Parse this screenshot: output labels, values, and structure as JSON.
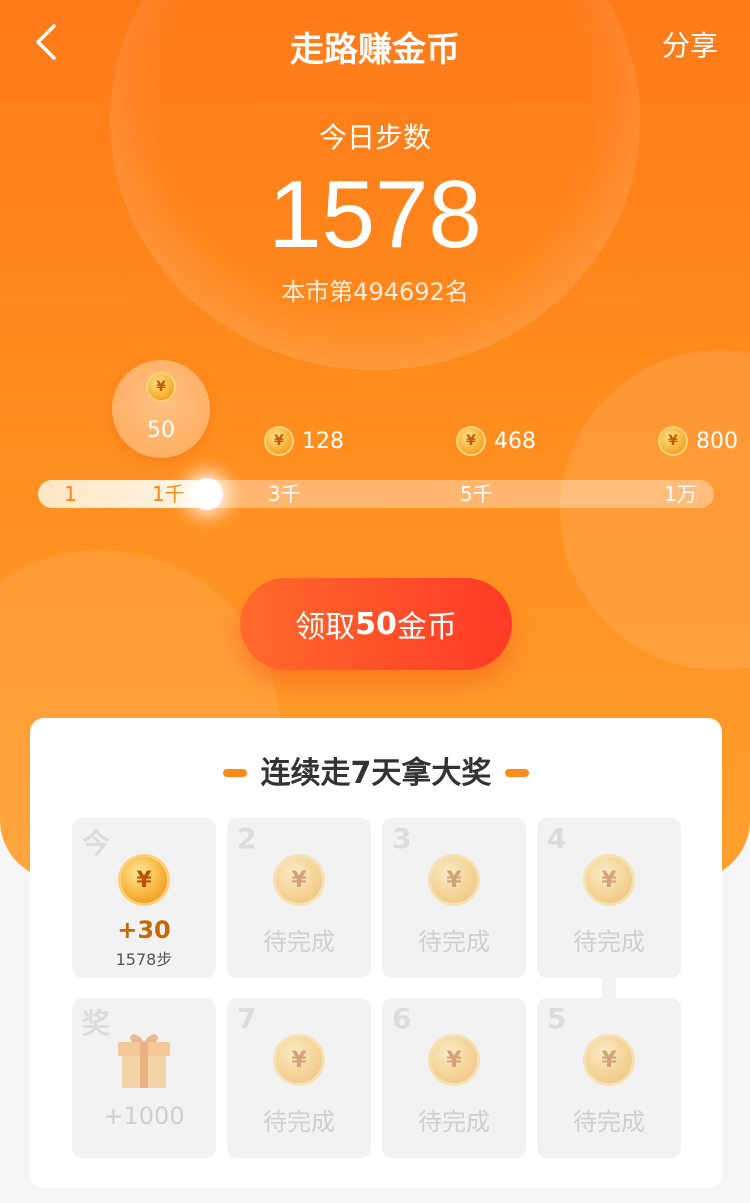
{
  "header": {
    "title": "走路赚金币",
    "share_label": "分享"
  },
  "steps": {
    "label": "今日步数",
    "value": "1578",
    "rank": "本市第494692名"
  },
  "milestones": {
    "current_bubble_reward": "50",
    "rewards": [
      "128",
      "468",
      "800"
    ],
    "coin_symbol": "¥",
    "ticks": [
      "1",
      "1千",
      "3千",
      "5千",
      "1万"
    ],
    "progress_fraction": 0.25
  },
  "claim": {
    "prefix": "领取",
    "amount": "50",
    "suffix": "金币"
  },
  "streak": {
    "title": "连续走7天拿大奖",
    "days": [
      {
        "label": "今",
        "reward": "+30",
        "steps": "1578步",
        "coin": "¥"
      },
      {
        "label": "2",
        "status": "待完成",
        "coin": "¥"
      },
      {
        "label": "3",
        "status": "待完成",
        "coin": "¥"
      },
      {
        "label": "4",
        "status": "待完成",
        "coin": "¥"
      },
      {
        "label": "奖",
        "status": "+1000"
      },
      {
        "label": "7",
        "status": "待完成",
        "coin": "¥"
      },
      {
        "label": "6",
        "status": "待完成",
        "coin": "¥"
      },
      {
        "label": "5",
        "status": "待完成",
        "coin": "¥"
      }
    ]
  },
  "colors": {
    "primary": "#ff7a1a",
    "button": "#ff3a28",
    "coin": "#f7b53a"
  }
}
